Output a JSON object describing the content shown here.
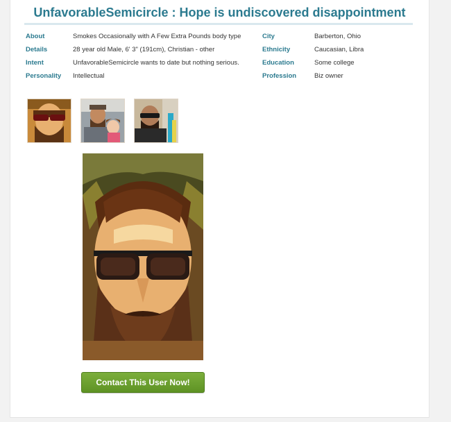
{
  "profile": {
    "title": "UnfavorableSemicircle : Hope is undiscovered disappointment",
    "left": [
      {
        "label": "About",
        "value": "Smokes Occasionally with A Few Extra Pounds body type"
      },
      {
        "label": "Details",
        "value": "28 year old Male, 6' 3\" (191cm), Christian - other"
      },
      {
        "label": "Intent",
        "value": "UnfavorableSemicircle wants to date but nothing serious."
      },
      {
        "label": "Personality",
        "value": "Intellectual"
      }
    ],
    "right": [
      {
        "label": "City",
        "value": "Barberton, Ohio"
      },
      {
        "label": "Ethnicity",
        "value": "Caucasian, Libra"
      },
      {
        "label": "Education",
        "value": "Some college"
      },
      {
        "label": "Profession",
        "value": "Biz owner"
      }
    ]
  },
  "contact_button": {
    "label": "Contact This User Now!"
  },
  "colors": {
    "accent": "#2b7a8f",
    "button": "#6a9e2c"
  }
}
